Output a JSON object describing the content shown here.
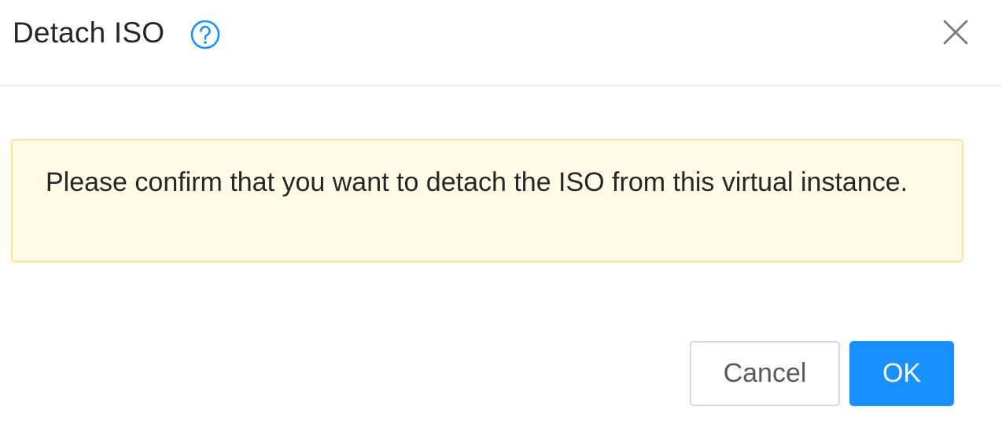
{
  "dialog": {
    "title": "Detach ISO",
    "help_icon": "question-circle-icon",
    "close_icon": "close-icon",
    "message": "Please confirm that you want to detach the ISO from this virtual instance.",
    "cancel_label": "Cancel",
    "ok_label": "OK"
  },
  "colors": {
    "accent": "#1890ff",
    "alert_background": "#fffbe6",
    "alert_border": "#ffe58f",
    "title_text": "#262626"
  }
}
